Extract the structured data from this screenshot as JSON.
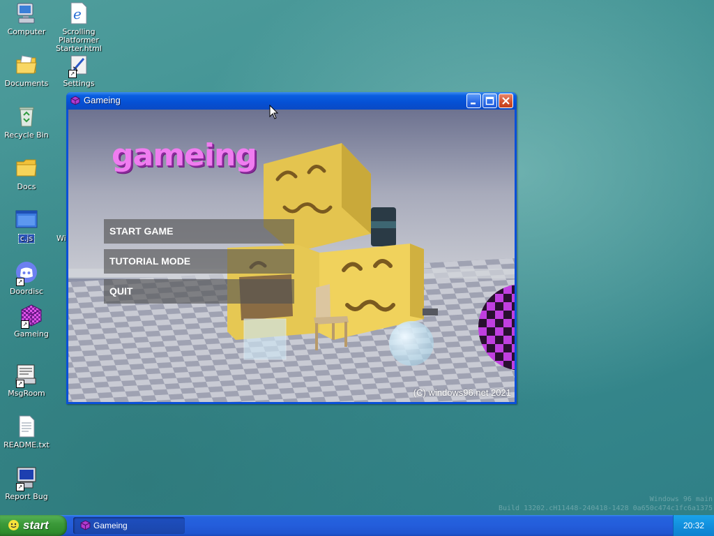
{
  "desktop": {
    "icons": [
      {
        "label": "Computer"
      },
      {
        "label": "Scrolling\nPlatformer\nStarter.html"
      },
      {
        "label": "Documents"
      },
      {
        "label": "Settings"
      },
      {
        "label": "Recycle Bin"
      },
      {
        "label": "Docs"
      },
      {
        "label": "c.js"
      },
      {
        "label": "Doordisc"
      },
      {
        "label": "Gameing"
      },
      {
        "label": "MsgRoom"
      },
      {
        "label": "README.txt"
      },
      {
        "label": "Report Bug"
      }
    ],
    "partial_label": "Wi"
  },
  "window": {
    "title": "Gameing",
    "game": {
      "title": "gameing",
      "menu": [
        "START GAME",
        "TUTORIAL MODE",
        "QUIT"
      ],
      "copyright": "(C) windows96.net 2021"
    }
  },
  "taskbar": {
    "start_label": "start",
    "tasks": [
      {
        "label": "Gameing"
      }
    ],
    "clock": "20:32"
  },
  "watermark": {
    "line1": "Windows 96 main",
    "line2": "Build 13202.cH11448-240418-1428 0a650c474c1fc6a1375"
  },
  "colors": {
    "accent": "#0a5ee0",
    "title_pink": "#f07cf0",
    "start_green": "#3c9a3a"
  }
}
